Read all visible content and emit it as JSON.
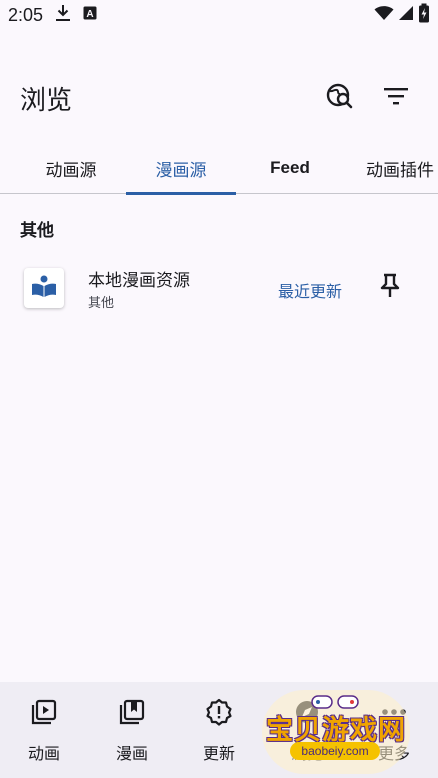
{
  "status_bar": {
    "time": "2:05",
    "icons": [
      "download-icon",
      "notification-a-icon",
      "wifi-icon",
      "signal-icon",
      "battery-charging-icon"
    ]
  },
  "app_bar": {
    "title": "浏览",
    "actions": [
      "globe-search-icon",
      "filter-icon"
    ]
  },
  "tabs": [
    {
      "label": "动画源",
      "active": false
    },
    {
      "label": "漫画源",
      "active": true
    },
    {
      "label": "Feed",
      "active": false
    },
    {
      "label": "动画插件",
      "active": false
    }
  ],
  "section": {
    "header": "其他"
  },
  "sources": [
    {
      "name": "本地漫画资源",
      "lang": "其他",
      "action_label": "最近更新",
      "icon": "book-reader-icon",
      "pin_icon": "pin-icon"
    }
  ],
  "bottom_nav": [
    {
      "label": "动画",
      "icon": "play-library-icon"
    },
    {
      "label": "漫画",
      "icon": "book-library-icon"
    },
    {
      "label": "更新",
      "icon": "alert-circle-icon"
    },
    {
      "label": "浏览",
      "icon": "explore-icon"
    },
    {
      "label": "更多",
      "icon": "more-horiz-icon"
    }
  ],
  "watermark": {
    "title": "宝贝游戏网",
    "url": "baobeiy.com"
  },
  "colors": {
    "accent": "#2b5fa6",
    "background": "#fbf8fd",
    "nav_background": "#efedf4",
    "text": "#1b1b1f"
  }
}
